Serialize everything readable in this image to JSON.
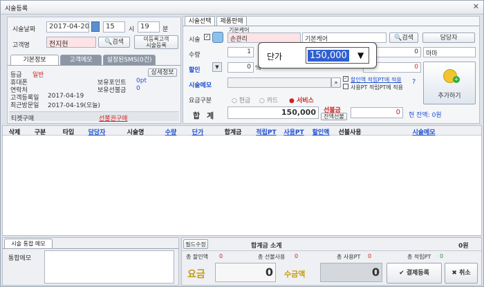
{
  "window": {
    "title": "시술등록",
    "close": "✕"
  },
  "left": {
    "date_label": "시술날짜",
    "date": "2017-04-20",
    "hour": "15",
    "hour_unit": "시",
    "minute": "19",
    "minute_unit": "분",
    "client_label": "고객명",
    "client": "전지현",
    "search_btn": "검색",
    "unreg_btn": "미등록고객\n시술등록",
    "tabs": [
      "기본정보",
      "고객메모",
      "설정된SMS(0건)"
    ],
    "grade_label": "등급",
    "grade": "일반",
    "detail_btn": "상세정보",
    "phone_label": "휴대폰",
    "points_label": "보유포인트",
    "points": "0pt",
    "contact_label": "연락처",
    "prepaid_label": "보유선불금",
    "prepaid": "0",
    "reg_label": "고객등록일",
    "reg_date": "2017-04-19",
    "last_label": "최근방문일",
    "last_date": "2017-04-19(오늘)",
    "ticket_label": "티켓구매",
    "ticket_link": "선불권구매"
  },
  "right": {
    "tabs": [
      "시술선택",
      "제품판매"
    ],
    "treat_label": "시술",
    "category_caption": "기본케어",
    "category": "손관리",
    "item": "기본케어",
    "search_btn": "검색",
    "staff_btn": "담당자",
    "qty_label": "수량",
    "qty": "1",
    "price": "0",
    "staff": "마마",
    "discount_label": "할인",
    "discount": "0",
    "discount_unit": "%",
    "discount_amt": "0",
    "memo_label": "시술메모",
    "memo_more": "»",
    "check1": "할인액 적립PT에 적용",
    "check2": "사용PT 적립PT에 적용",
    "help": "?",
    "add_btn": "추가하기",
    "pay_label": "요금구분",
    "pay_opts": [
      "현금",
      "카드",
      "서비스"
    ],
    "total_label": "합  계",
    "total": "150,000",
    "prepay_label": "선불금",
    "prepay_btn": "잔액선불",
    "prepay_amt": "0",
    "balance_label": "현 잔액: 0원"
  },
  "popup": {
    "label": "단가",
    "value": "150,000",
    "arrow": "▼"
  },
  "grid": {
    "headers": [
      "삭제",
      "구분",
      "타입",
      "담당자",
      "시술명",
      "수량",
      "단가",
      "합계금",
      "적립PT",
      "사용PT",
      "할인액",
      "선불사용",
      "시술메모"
    ]
  },
  "bottom": {
    "memo_tab": "시술 통합 메모",
    "memo_label": "통합메모",
    "field_btn": "필드수정",
    "subtotal_label": "합계금 소계",
    "subtotal": "0원",
    "s1": "총 할인액",
    "s1v": "0",
    "s2": "총 선불사용",
    "s2v": "0",
    "s3": "총 사용PT",
    "s3v": "0",
    "s4": "총 적립PT",
    "s4v": "0",
    "fee_label": "요금",
    "fee": "0",
    "recv_label": "수금액",
    "recv": "0",
    "pay_btn": "결제등록",
    "cancel_btn": "취소"
  }
}
